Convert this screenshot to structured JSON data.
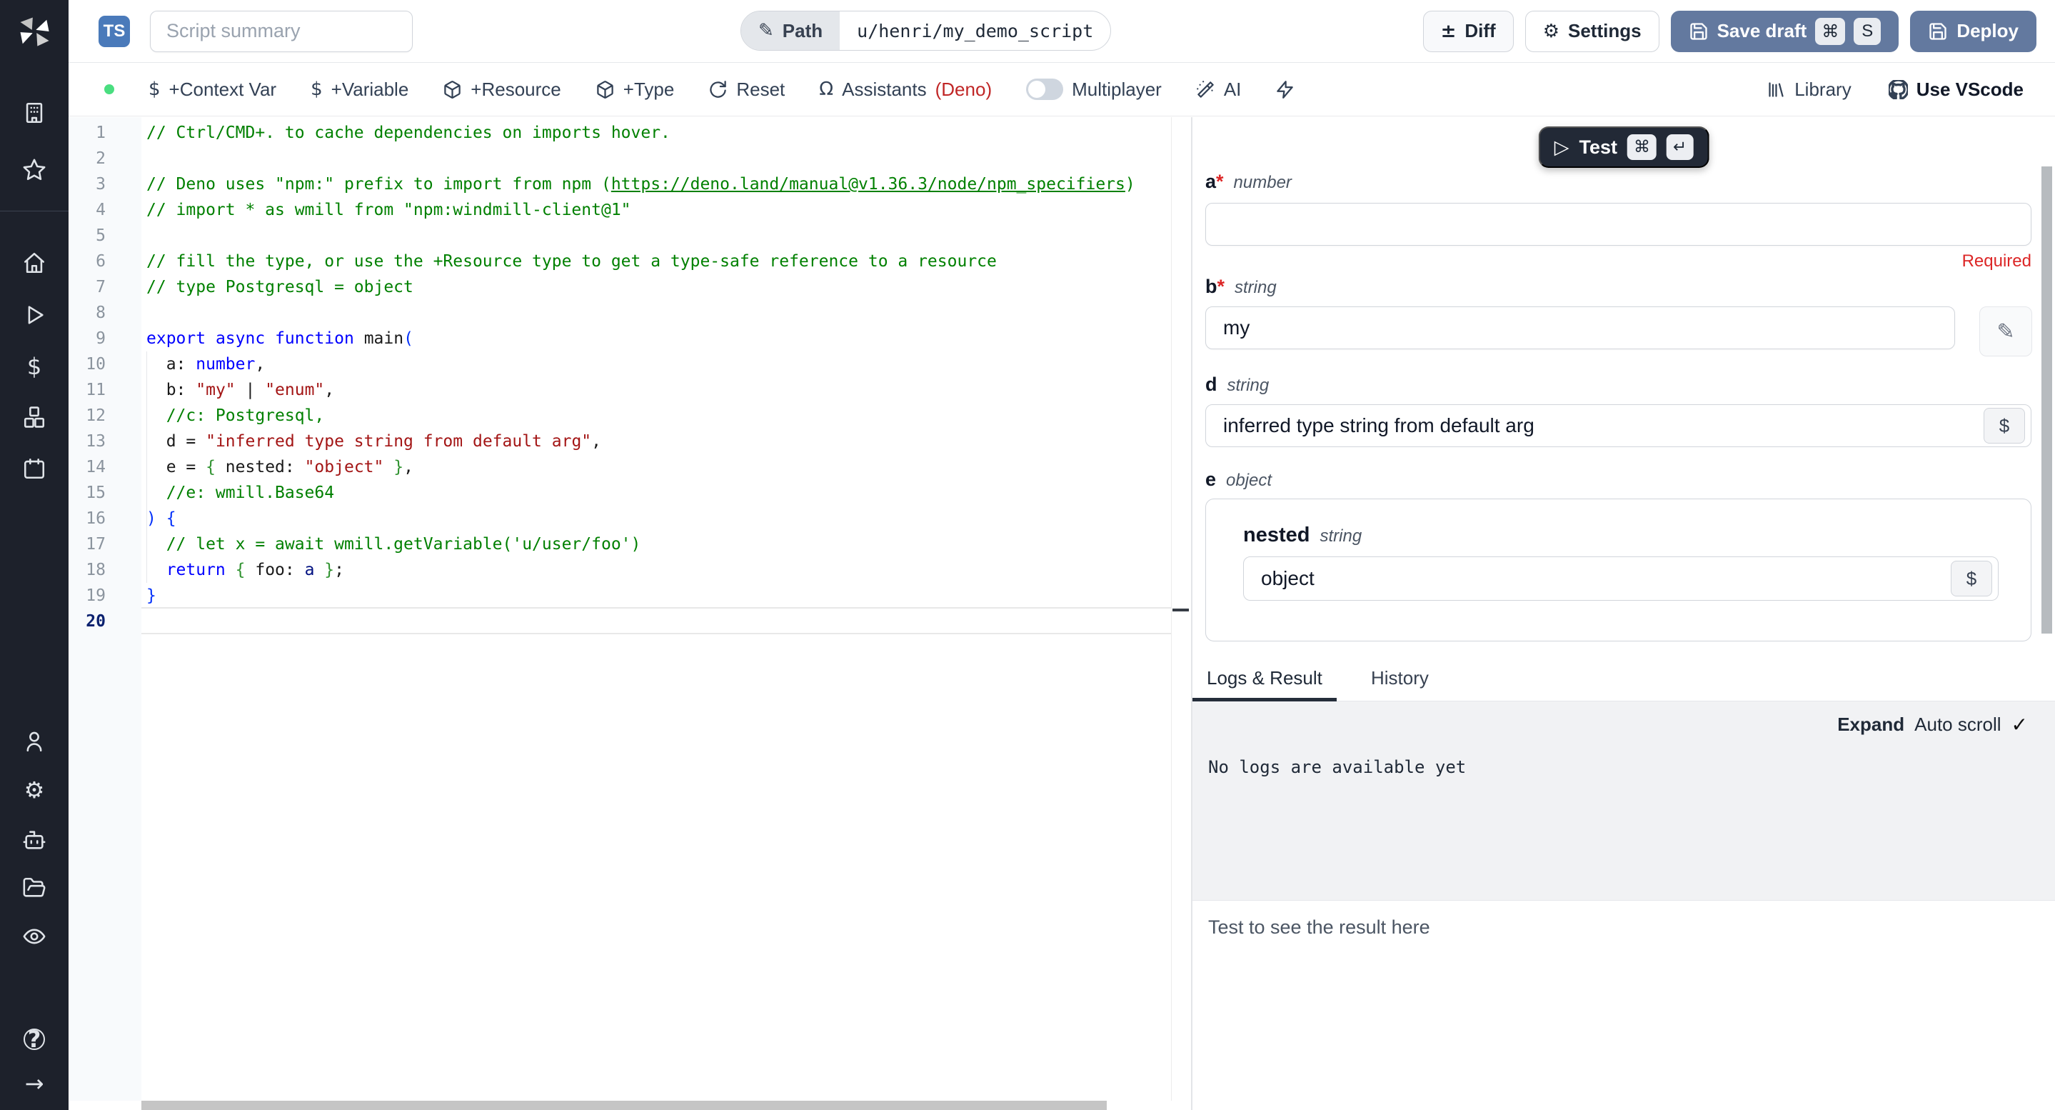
{
  "app": {
    "title": "Windmill Script Editor"
  },
  "colors": {
    "sidebar_bg": "#1d212b",
    "accent_blue": "#4a7aba",
    "slate_button": "#63799f",
    "dark_button": "#222936",
    "success_green": "#4ade80",
    "error_red": "#dc2626",
    "runtime_red": "#c02626",
    "comment_green": "#008000",
    "keyword_blue": "#0000ff",
    "string_red": "#a31515",
    "bracket1": "#0431fa",
    "bracket2": "#319331"
  },
  "icons": {
    "dollar": "$",
    "omega": "Ω",
    "pencil": "✎",
    "gear": "⚙",
    "plus_minus": "±",
    "play": "▷",
    "cmd": "⌘",
    "enter": "↵",
    "check": "✓",
    "question": "?",
    "arrow_right": "→"
  },
  "sidebar": {
    "items": [
      "workspace",
      "favorites",
      "home",
      "runs",
      "variables",
      "resources",
      "schedules",
      "users",
      "settings",
      "workers",
      "folders",
      "audit-logs",
      "help",
      "collapse"
    ]
  },
  "header": {
    "ts_badge": "TS",
    "summary_placeholder": "Script summary",
    "path_label": "Path",
    "path_value": "u/henri/my_demo_script",
    "diff": "Diff",
    "settings": "Settings",
    "save_draft": "Save draft",
    "kbd_cmd": "⌘",
    "kbd_s": "S",
    "deploy": "Deploy"
  },
  "toolbar": {
    "context_var": "+Context Var",
    "variable": "+Variable",
    "resource": "+Resource",
    "type": "+Type",
    "reset": "Reset",
    "assistants": "Assistants",
    "runtime": "(Deno)",
    "multiplayer": "Multiplayer",
    "ai": "AI",
    "library": "Library",
    "use_vscode": "Use VScode"
  },
  "editor": {
    "current_line": 20,
    "lines": [
      {
        "n": 1,
        "seg": [
          {
            "c": "com",
            "t": "// Ctrl/CMD+. to cache dependencies on imports hover."
          }
        ]
      },
      {
        "n": 2,
        "seg": []
      },
      {
        "n": 3,
        "seg": [
          {
            "c": "com",
            "t": "// Deno uses \"npm:\" prefix to import from npm ("
          },
          {
            "c": "link",
            "t": "https://deno.land/manual@v1.36.3/node/npm_specifiers"
          },
          {
            "c": "com",
            "t": ")"
          }
        ]
      },
      {
        "n": 4,
        "seg": [
          {
            "c": "com",
            "t": "// import * as wmill from \"npm:windmill-client@1\""
          }
        ]
      },
      {
        "n": 5,
        "seg": []
      },
      {
        "n": 6,
        "seg": [
          {
            "c": "com",
            "t": "// fill the type, or use the +Resource type to get a type-safe reference to a resource"
          }
        ]
      },
      {
        "n": 7,
        "seg": [
          {
            "c": "com",
            "t": "// type Postgresql = object"
          }
        ]
      },
      {
        "n": 8,
        "seg": []
      },
      {
        "n": 9,
        "seg": [
          {
            "c": "kw",
            "t": "export"
          },
          {
            "c": "txt",
            "t": " "
          },
          {
            "c": "kw",
            "t": "async"
          },
          {
            "c": "txt",
            "t": " "
          },
          {
            "c": "kw",
            "t": "function"
          },
          {
            "c": "txt",
            "t": " main"
          },
          {
            "c": "b1",
            "t": "("
          }
        ]
      },
      {
        "n": 10,
        "seg": [
          {
            "c": "txt",
            "t": "  a: "
          },
          {
            "c": "kw",
            "t": "number"
          },
          {
            "c": "txt",
            "t": ","
          }
        ]
      },
      {
        "n": 11,
        "seg": [
          {
            "c": "txt",
            "t": "  b: "
          },
          {
            "c": "str",
            "t": "\"my\""
          },
          {
            "c": "txt",
            "t": " | "
          },
          {
            "c": "str",
            "t": "\"enum\""
          },
          {
            "c": "txt",
            "t": ","
          }
        ]
      },
      {
        "n": 12,
        "seg": [
          {
            "c": "com",
            "t": "  //c: Postgresql,"
          }
        ]
      },
      {
        "n": 13,
        "seg": [
          {
            "c": "txt",
            "t": "  d = "
          },
          {
            "c": "str",
            "t": "\"inferred type string from default arg\""
          },
          {
            "c": "txt",
            "t": ","
          }
        ]
      },
      {
        "n": 14,
        "seg": [
          {
            "c": "txt",
            "t": "  e = "
          },
          {
            "c": "b2",
            "t": "{"
          },
          {
            "c": "txt",
            "t": " nested: "
          },
          {
            "c": "str",
            "t": "\"object\""
          },
          {
            "c": "b2",
            "t": " }"
          },
          {
            "c": "txt",
            "t": ","
          }
        ]
      },
      {
        "n": 15,
        "seg": [
          {
            "c": "com",
            "t": "  //e: wmill.Base64"
          }
        ]
      },
      {
        "n": 16,
        "seg": [
          {
            "c": "b1",
            "t": ") {"
          }
        ]
      },
      {
        "n": 17,
        "seg": [
          {
            "c": "com",
            "t": "  // let x = await wmill.getVariable('u/user/foo')"
          }
        ]
      },
      {
        "n": 18,
        "seg": [
          {
            "c": "kw",
            "t": "  return"
          },
          {
            "c": "txt",
            "t": " "
          },
          {
            "c": "b2",
            "t": "{"
          },
          {
            "c": "txt",
            "t": " foo: "
          },
          {
            "c": "var",
            "t": "a"
          },
          {
            "c": "b2",
            "t": " }"
          },
          {
            "c": "txt",
            "t": ";"
          }
        ]
      },
      {
        "n": 19,
        "seg": [
          {
            "c": "b1",
            "t": "}"
          }
        ]
      },
      {
        "n": 20,
        "seg": []
      }
    ]
  },
  "panel": {
    "test": "Test",
    "dollar_btn": "$",
    "fields": {
      "a": {
        "name": "a",
        "required": "*",
        "type": "number",
        "value": "",
        "error": "Required"
      },
      "b": {
        "name": "b",
        "required": "*",
        "type": "string",
        "value": "my"
      },
      "d": {
        "name": "d",
        "type": "string",
        "value": "inferred type string from default arg"
      },
      "e": {
        "name": "e",
        "type": "object",
        "nested": {
          "name": "nested",
          "type": "string",
          "value": "object"
        }
      }
    },
    "tabs": {
      "logs": "Logs & Result",
      "history": "History"
    },
    "logs": {
      "expand": "Expand",
      "auto_scroll": "Auto scroll",
      "empty": "No logs are available yet"
    },
    "result": {
      "placeholder": "Test to see the result here"
    }
  }
}
